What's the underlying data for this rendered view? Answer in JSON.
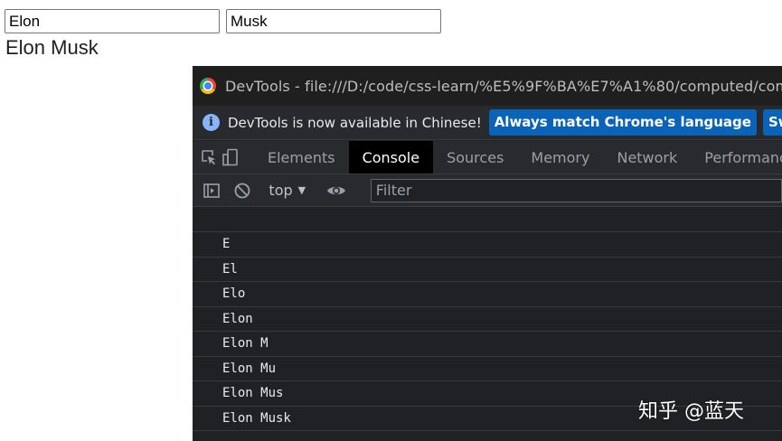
{
  "page": {
    "first_name_value": "Elon",
    "last_name_value": "Musk",
    "full_name": "Elon Musk"
  },
  "devtools": {
    "title": "DevTools - file:///D:/code/css-learn/%E5%9F%BA%E7%A1%80/computed/comp",
    "infobar": {
      "message": "DevTools is now available in Chinese!",
      "button_match": "Always match Chrome's language",
      "button_switch": "Switch Dev"
    },
    "tabs": [
      "Elements",
      "Console",
      "Sources",
      "Memory",
      "Network",
      "Performance"
    ],
    "active_tab": "Console",
    "toolbar": {
      "context": "top",
      "filter_placeholder": "Filter"
    },
    "console_lines": [
      "E",
      "El",
      "Elo",
      "Elon",
      "Elon M",
      "Elon Mu",
      "Elon Mus",
      "Elon Musk"
    ]
  },
  "watermark": "知乎 @蓝天",
  "icons": {
    "inspect": "inspect-element-icon",
    "device": "device-toolbar-icon",
    "sidebar": "console-sidebar-icon",
    "clear": "clear-console-icon",
    "eye": "live-expression-eye-icon",
    "info": "info-icon",
    "chrome": "chrome-logo-icon"
  }
}
